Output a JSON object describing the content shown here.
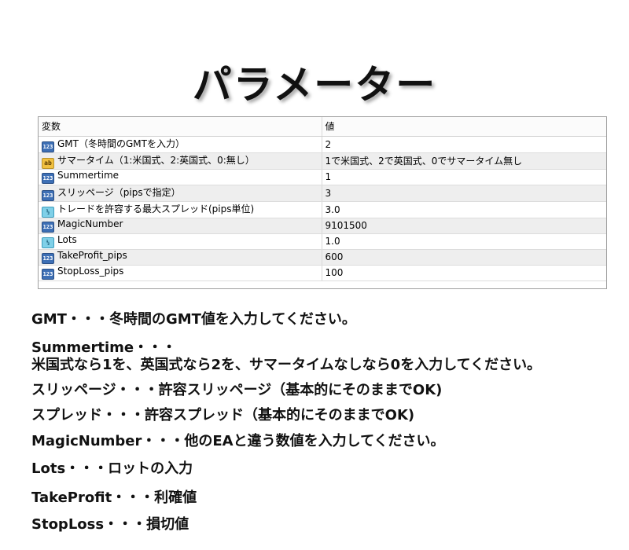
{
  "title": "パラメーター",
  "table": {
    "headers": [
      "変数",
      "値"
    ],
    "rows": [
      {
        "icon": "int-type-icon",
        "name": "GMT（冬時間のGMTを入力）",
        "value": "2"
      },
      {
        "icon": "string-type-icon",
        "name": "サマータイム（1:米国式、2:英国式、0:無し）",
        "value": "1で米国式、2で英国式、0でサマータイム無し"
      },
      {
        "icon": "int-type-icon",
        "name": "Summertime",
        "value": "1"
      },
      {
        "icon": "int-type-icon",
        "name": "スリッページ（pipsで指定）",
        "value": "3"
      },
      {
        "icon": "double-type-icon",
        "name": "トレードを許容する最大スプレッド(pips単位)",
        "value": "3.0"
      },
      {
        "icon": "int-type-icon",
        "name": "MagicNumber",
        "value": "9101500"
      },
      {
        "icon": "double-type-icon",
        "name": "Lots",
        "value": "1.0"
      },
      {
        "icon": "int-type-icon",
        "name": "TakeProfit_pips",
        "value": "600"
      },
      {
        "icon": "int-type-icon",
        "name": "StopLoss_pips",
        "value": "100"
      }
    ]
  },
  "descriptions": [
    "GMT・・・冬時間のGMT値を入力してください。",
    "Summertime・・・",
    "米国式なら1を、英国式なら2を、サマータイムなしなら0を入力してください。",
    "スリッページ・・・許容スリッページ（基本的にそのままでOK)",
    "スプレッド・・・許容スプレッド（基本的にそのままでOK)",
    "MagicNumber・・・他のEAと違う数値を入力してください。",
    "Lots・・・ロットの入力",
    "TakeProfit・・・利確値",
    "StopLoss・・・損切値"
  ]
}
